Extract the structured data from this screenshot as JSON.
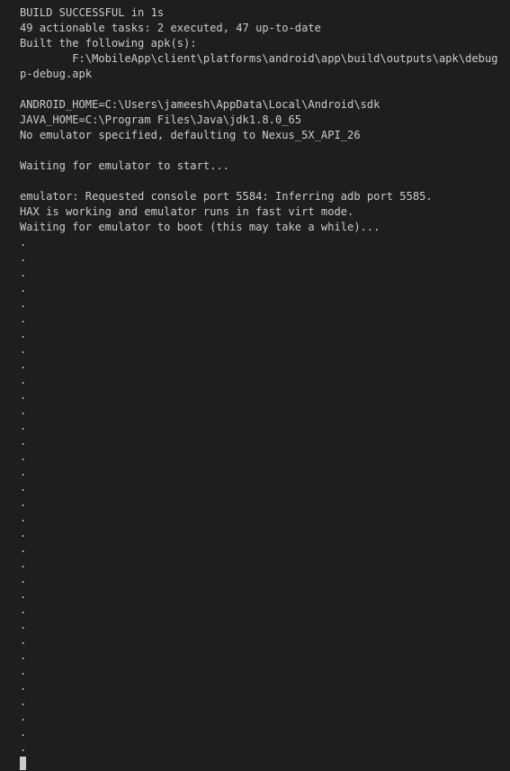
{
  "terminal": {
    "lines": [
      "BUILD SUCCESSFUL in 1s",
      "49 actionable tasks: 2 executed, 47 up-to-date",
      "Built the following apk(s):",
      "        F:\\MobileApp\\client\\platforms\\android\\app\\build\\outputs\\apk\\debug\\ap",
      "p-debug.apk",
      "",
      "ANDROID_HOME=C:\\Users\\jameesh\\AppData\\Local\\Android\\sdk",
      "JAVA_HOME=C:\\Program Files\\Java\\jdk1.8.0_65",
      "No emulator specified, defaulting to Nexus_5X_API_26",
      "",
      "Waiting for emulator to start...",
      "",
      "emulator: Requested console port 5584: Inferring adb port 5585.",
      "HAX is working and emulator runs in fast virt mode.",
      "Waiting for emulator to boot (this may take a while)...",
      ".",
      ".",
      ".",
      ".",
      ".",
      ".",
      ".",
      ".",
      ".",
      ".",
      ".",
      ".",
      ".",
      ".",
      ".",
      ".",
      ".",
      ".",
      ".",
      ".",
      ".",
      ".",
      ".",
      ".",
      ".",
      ".",
      ".",
      ".",
      ".",
      ".",
      ".",
      ".",
      ".",
      "."
    ]
  }
}
